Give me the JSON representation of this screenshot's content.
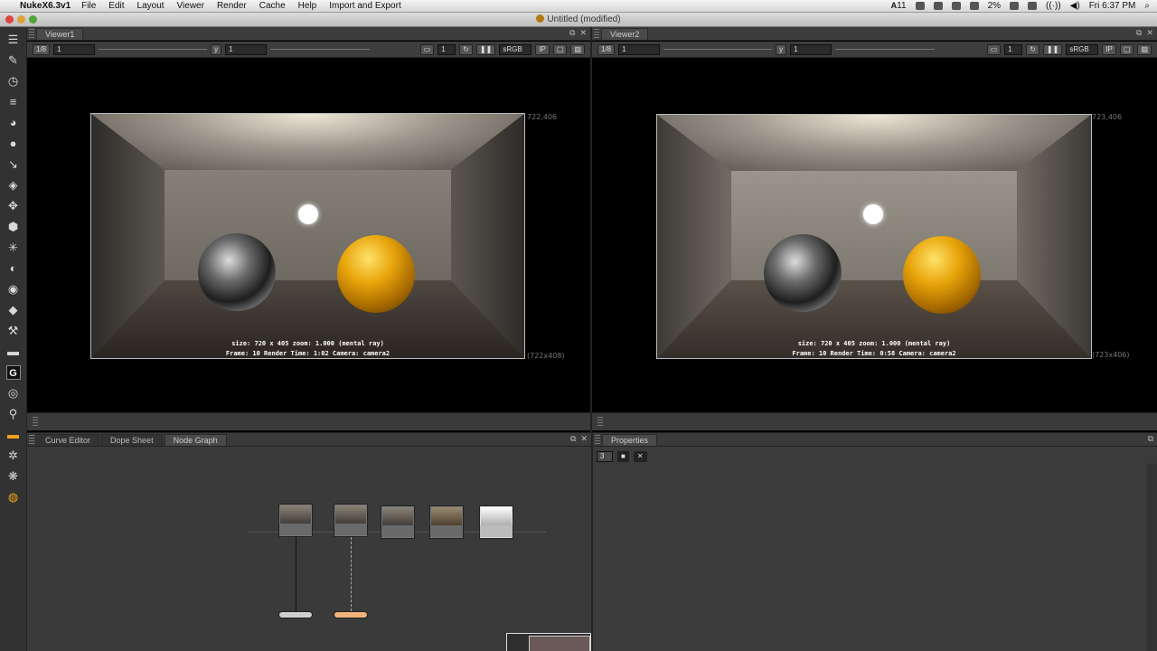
{
  "menubar": {
    "app_name": "NukeX6.3v1",
    "menus": [
      "File",
      "Edit",
      "Layout",
      "Viewer",
      "Render",
      "Cache",
      "Help",
      "Import and Export"
    ],
    "status_right": {
      "adobe_badge": "11",
      "battery": "2%",
      "clock": "Fri 6:37 PM"
    }
  },
  "window": {
    "title": "Untitled (modified)"
  },
  "viewer1": {
    "tab": "Viewer1",
    "frame_field": "1/8",
    "frame_value": "1",
    "y_label": "y",
    "y_value": "1",
    "channel_count": "1",
    "colorspace": "sRGB",
    "ip_label": "IP",
    "corner_top": "722,406",
    "corner_bottom": "(722x408)",
    "overlay_line1": "size: 720 x 405 zoom: 1.000      (mental ray)",
    "overlay_line2": "Frame: 10    Render Time: 1:02     Camera: camera2"
  },
  "viewer2": {
    "tab": "Viewer2",
    "frame_field": "1/8",
    "frame_value": "1",
    "y_value": "1",
    "channel_count": "1",
    "colorspace": "sRGB",
    "ip_label": "IP",
    "corner_top": "723,406",
    "corner_bottom": "(723x406)",
    "overlay_line1": "size: 720 x 405 zoom: 1.000      (mental ray)",
    "overlay_line2": "Frame: 10    Render Time: 0:58     Camera: camera2"
  },
  "bottom_left": {
    "tabs": [
      "Curve Editor",
      "Dope Sheet",
      "Node Graph"
    ],
    "active_tab": "Node Graph"
  },
  "properties": {
    "tab": "Properties",
    "count_field": "3"
  },
  "colors": {
    "node_orange": "#f0b27a",
    "node_gray": "#cfcfcf",
    "accent_orange": "#f2a51a"
  }
}
